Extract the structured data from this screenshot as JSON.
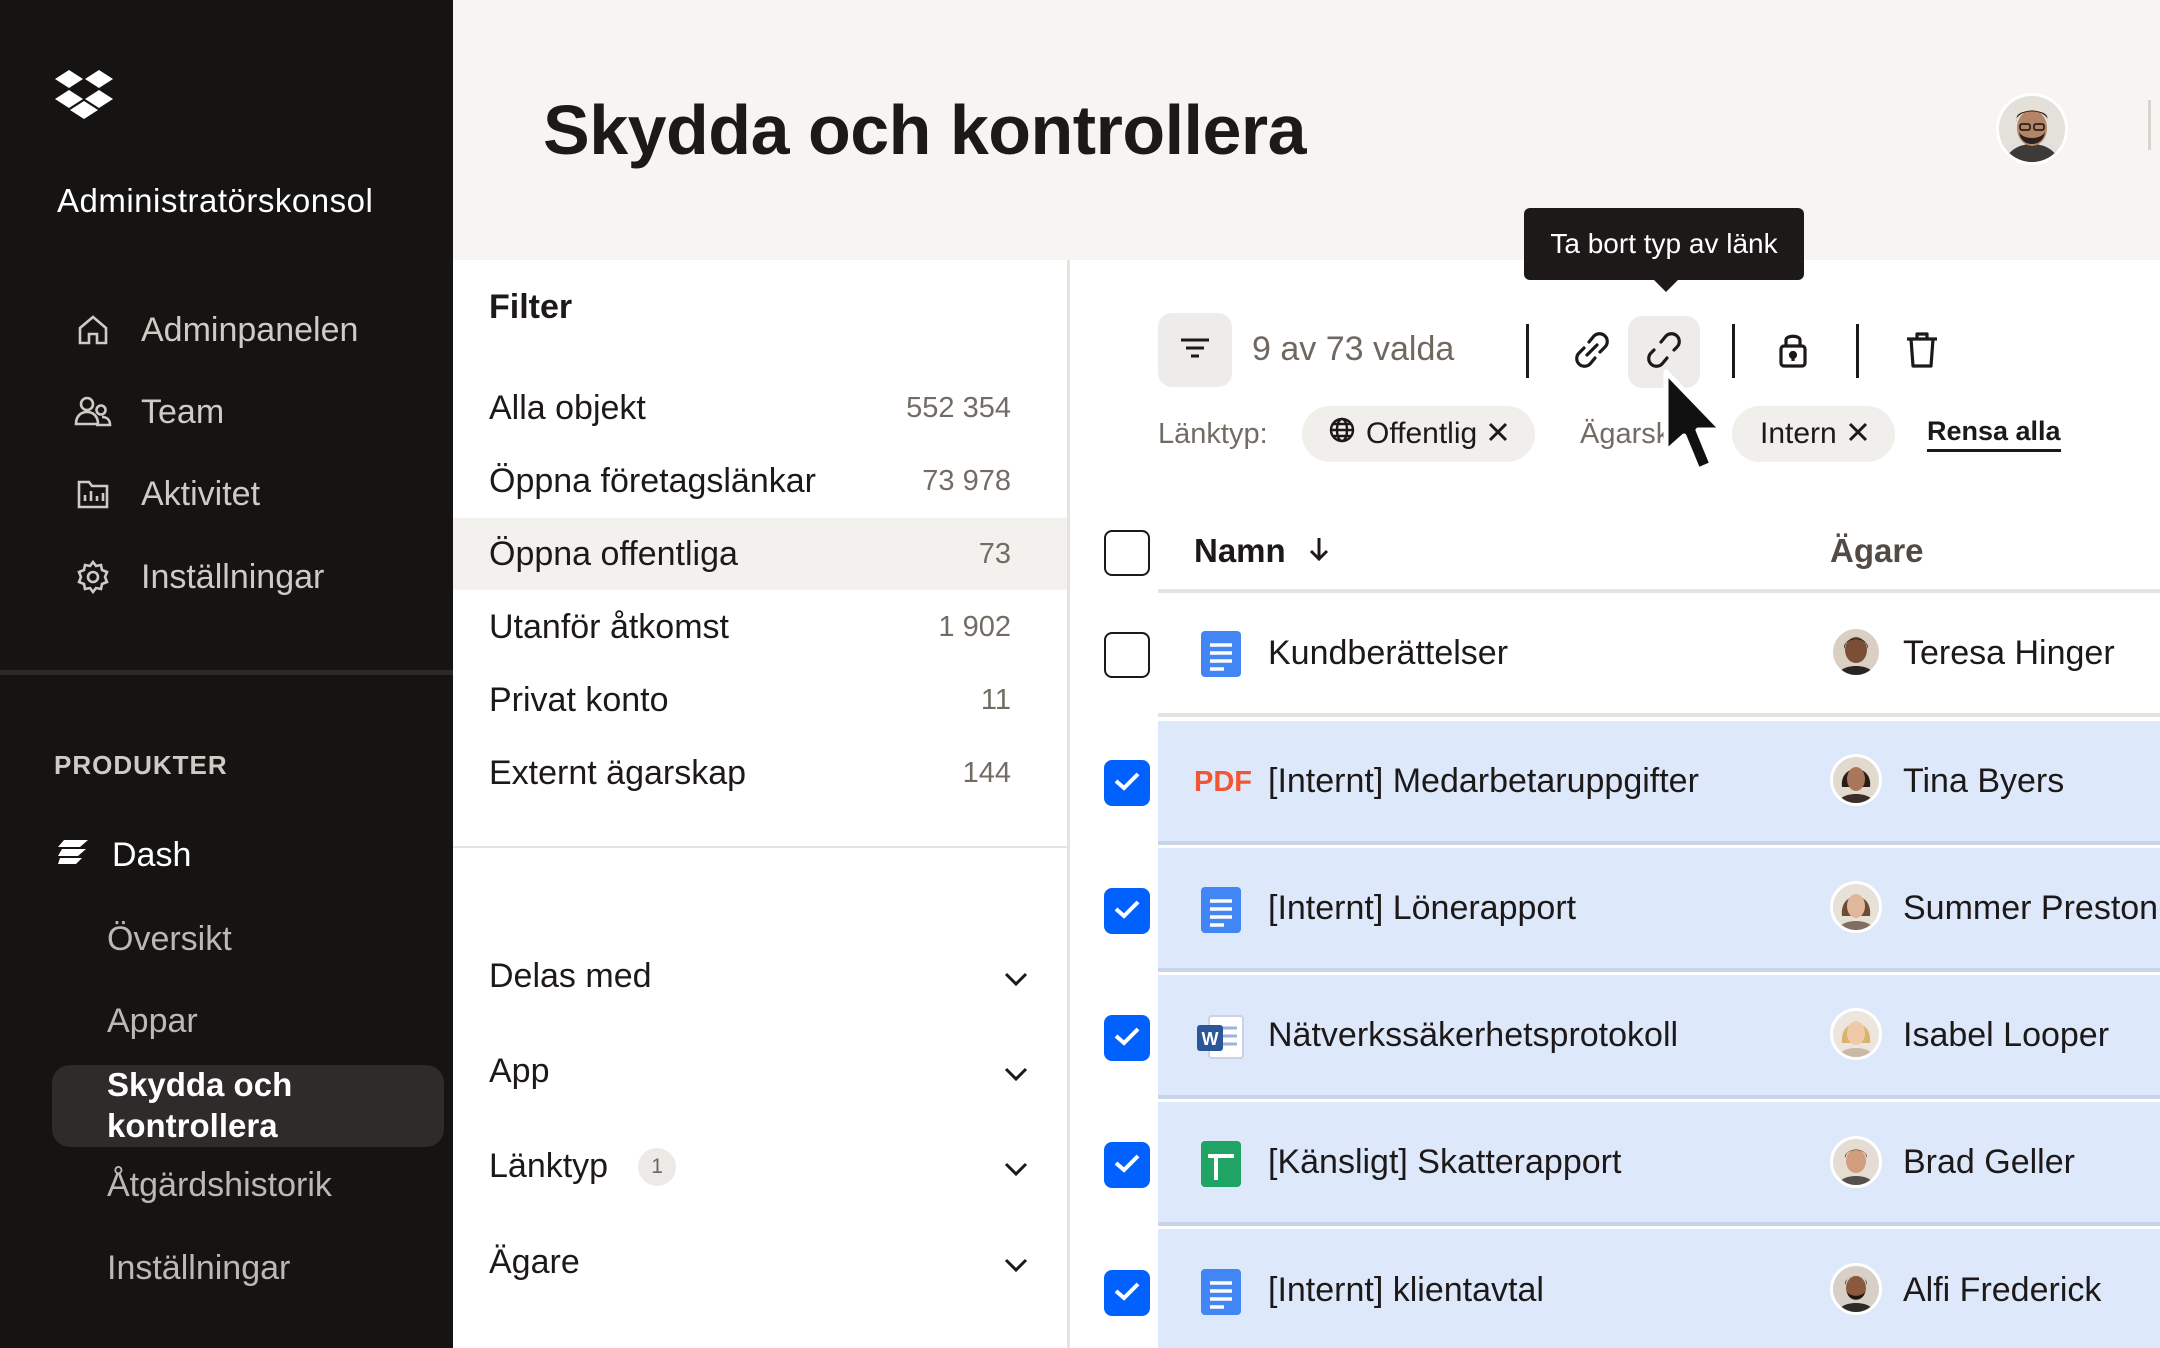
{
  "sidebar": {
    "console_title": "Administratörskonsol",
    "nav": [
      {
        "label": "Adminpanelen",
        "icon": "home-icon"
      },
      {
        "label": "Team",
        "icon": "team-icon"
      },
      {
        "label": "Aktivitet",
        "icon": "activity-icon"
      },
      {
        "label": "Inställningar",
        "icon": "gear-icon"
      }
    ],
    "products_label": "PRODUKTER",
    "dash_label": "Dash",
    "sub_items": [
      "Översikt",
      "Appar",
      "Skydda och kontrollera",
      "Åtgärdshistorik",
      "Inställningar"
    ],
    "active_sub": "Skydda och kontrollera"
  },
  "header": {
    "title": "Skydda och kontrollera"
  },
  "filters": {
    "title": "Filter",
    "items": [
      {
        "label": "Alla objekt",
        "count": "552 354"
      },
      {
        "label": "Öppna företagslänkar",
        "count": "73 978"
      },
      {
        "label": "Öppna offentliga",
        "count": "73"
      },
      {
        "label": "Utanför åtkomst",
        "count": "1 902"
      },
      {
        "label": "Privat konto",
        "count": "11"
      },
      {
        "label": "Externt ägarskap",
        "count": "144"
      }
    ],
    "accordions": [
      {
        "label": "Delas med"
      },
      {
        "label": "App"
      },
      {
        "label": "Länktyp",
        "badge": "1"
      },
      {
        "label": "Ägare"
      }
    ]
  },
  "toolbar": {
    "selected_text": "9 av 73 valda",
    "tooltip": "Ta bort typ av länk",
    "link_type_label": "Länktyp:",
    "chip_public": "Offentlig",
    "owner_label": "Ägarskap:",
    "chip_internal": "Intern",
    "clear_all": "Rensa alla"
  },
  "table": {
    "col_name": "Namn",
    "col_owner": "Ägare",
    "rows": [
      {
        "name": "Kundberättelser",
        "owner": "Teresa Hinger",
        "selected": false,
        "type": "doc"
      },
      {
        "name": "[Internt] Medarbetaruppgifter",
        "owner": "Tina Byers",
        "selected": true,
        "type": "pdf",
        "type_label": "PDF"
      },
      {
        "name": "[Internt] Lönerapport",
        "owner": "Summer Preston",
        "selected": true,
        "type": "doc"
      },
      {
        "name": "Nätverkssäkerhetsprotokoll",
        "owner": "Isabel Looper",
        "selected": true,
        "type": "word"
      },
      {
        "name": "[Känsligt] Skatterapport",
        "owner": "Brad Geller",
        "selected": true,
        "type": "sheet"
      },
      {
        "name": "[Internt] klientavtal",
        "owner": "Alfi Frederick",
        "selected": true,
        "type": "doc"
      }
    ]
  },
  "colors": {
    "accent": "#0061fe",
    "selected_row": "#dde8fa",
    "sidebar_bg": "#161313",
    "pdf_red": "#f25533",
    "sheet_green": "#1fa463",
    "doc_blue": "#4285f4"
  }
}
